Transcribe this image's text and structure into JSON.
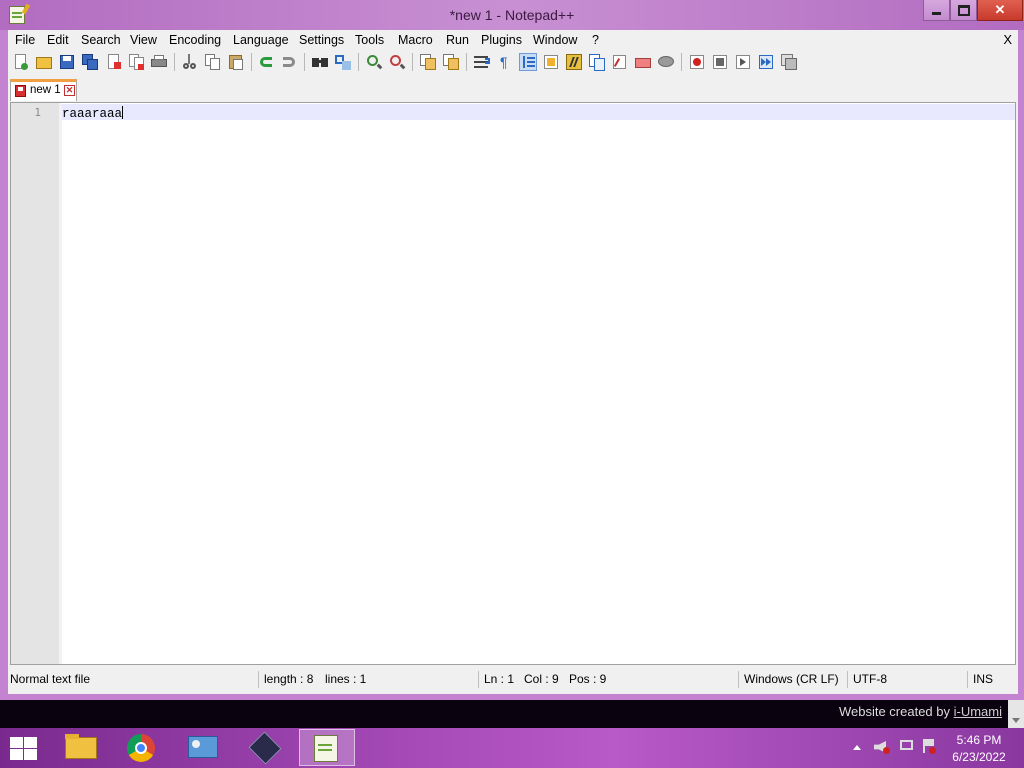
{
  "window": {
    "title": "*new 1 - Notepad++",
    "controls": {
      "minimize": "minimize",
      "maximize": "maximize",
      "close": "✕"
    }
  },
  "menu": {
    "items": [
      "File",
      "Edit",
      "Search",
      "View",
      "Encoding",
      "Language",
      "Settings",
      "Tools",
      "Macro",
      "Run",
      "Plugins",
      "Window",
      "?"
    ],
    "close_label": "X"
  },
  "toolbar": {
    "icons": [
      "new-file-icon",
      "open-file-icon",
      "save-icon",
      "save-all-icon",
      "close-icon",
      "close-all-icon",
      "print-icon",
      "cut-icon",
      "copy-icon",
      "paste-icon",
      "undo-icon",
      "redo-icon",
      "find-icon",
      "replace-icon",
      "zoom-in-icon",
      "zoom-out-icon",
      "sync-vertical-icon",
      "sync-horizontal-icon",
      "word-wrap-icon",
      "show-all-characters-icon",
      "indent-guide-icon",
      "user-defined-language-icon",
      "document-map-icon",
      "function-list-icon",
      "folder-as-workspace-icon",
      "monitoring-icon",
      "record-macro-icon",
      "stop-recording-icon",
      "play-macro-icon",
      "run-macro-multiple-icon",
      "save-macro-icon"
    ],
    "active_icon": "indent-guide-icon"
  },
  "tabs": [
    {
      "label": "new 1",
      "close": "✕"
    }
  ],
  "editor": {
    "lines": [
      {
        "number": "1",
        "text": "raaaraaa"
      }
    ]
  },
  "status": {
    "file_type": "Normal text file",
    "length": "length : 8",
    "lines": "lines : 1",
    "ln": "Ln : 1",
    "col": "Col : 9",
    "pos": "Pos : 9",
    "eol": "Windows (CR LF)",
    "encoding": "UTF-8",
    "mode": "INS"
  },
  "wallpaper": {
    "credit_text": "Website created by ",
    "credit_link": "i-Umami"
  },
  "taskbar": {
    "apps": [
      "file-explorer",
      "chrome",
      "control-panel",
      "nexus",
      "notepad-plus-plus"
    ],
    "active_app": "notepad-plus-plus",
    "time": "5:46 PM",
    "date": "6/23/2022"
  },
  "colors": {
    "window_frame": "#c483d0",
    "current_line": "#e8e8ff",
    "tab_accent": "#f0a040",
    "taskbar": "#a046b2"
  }
}
